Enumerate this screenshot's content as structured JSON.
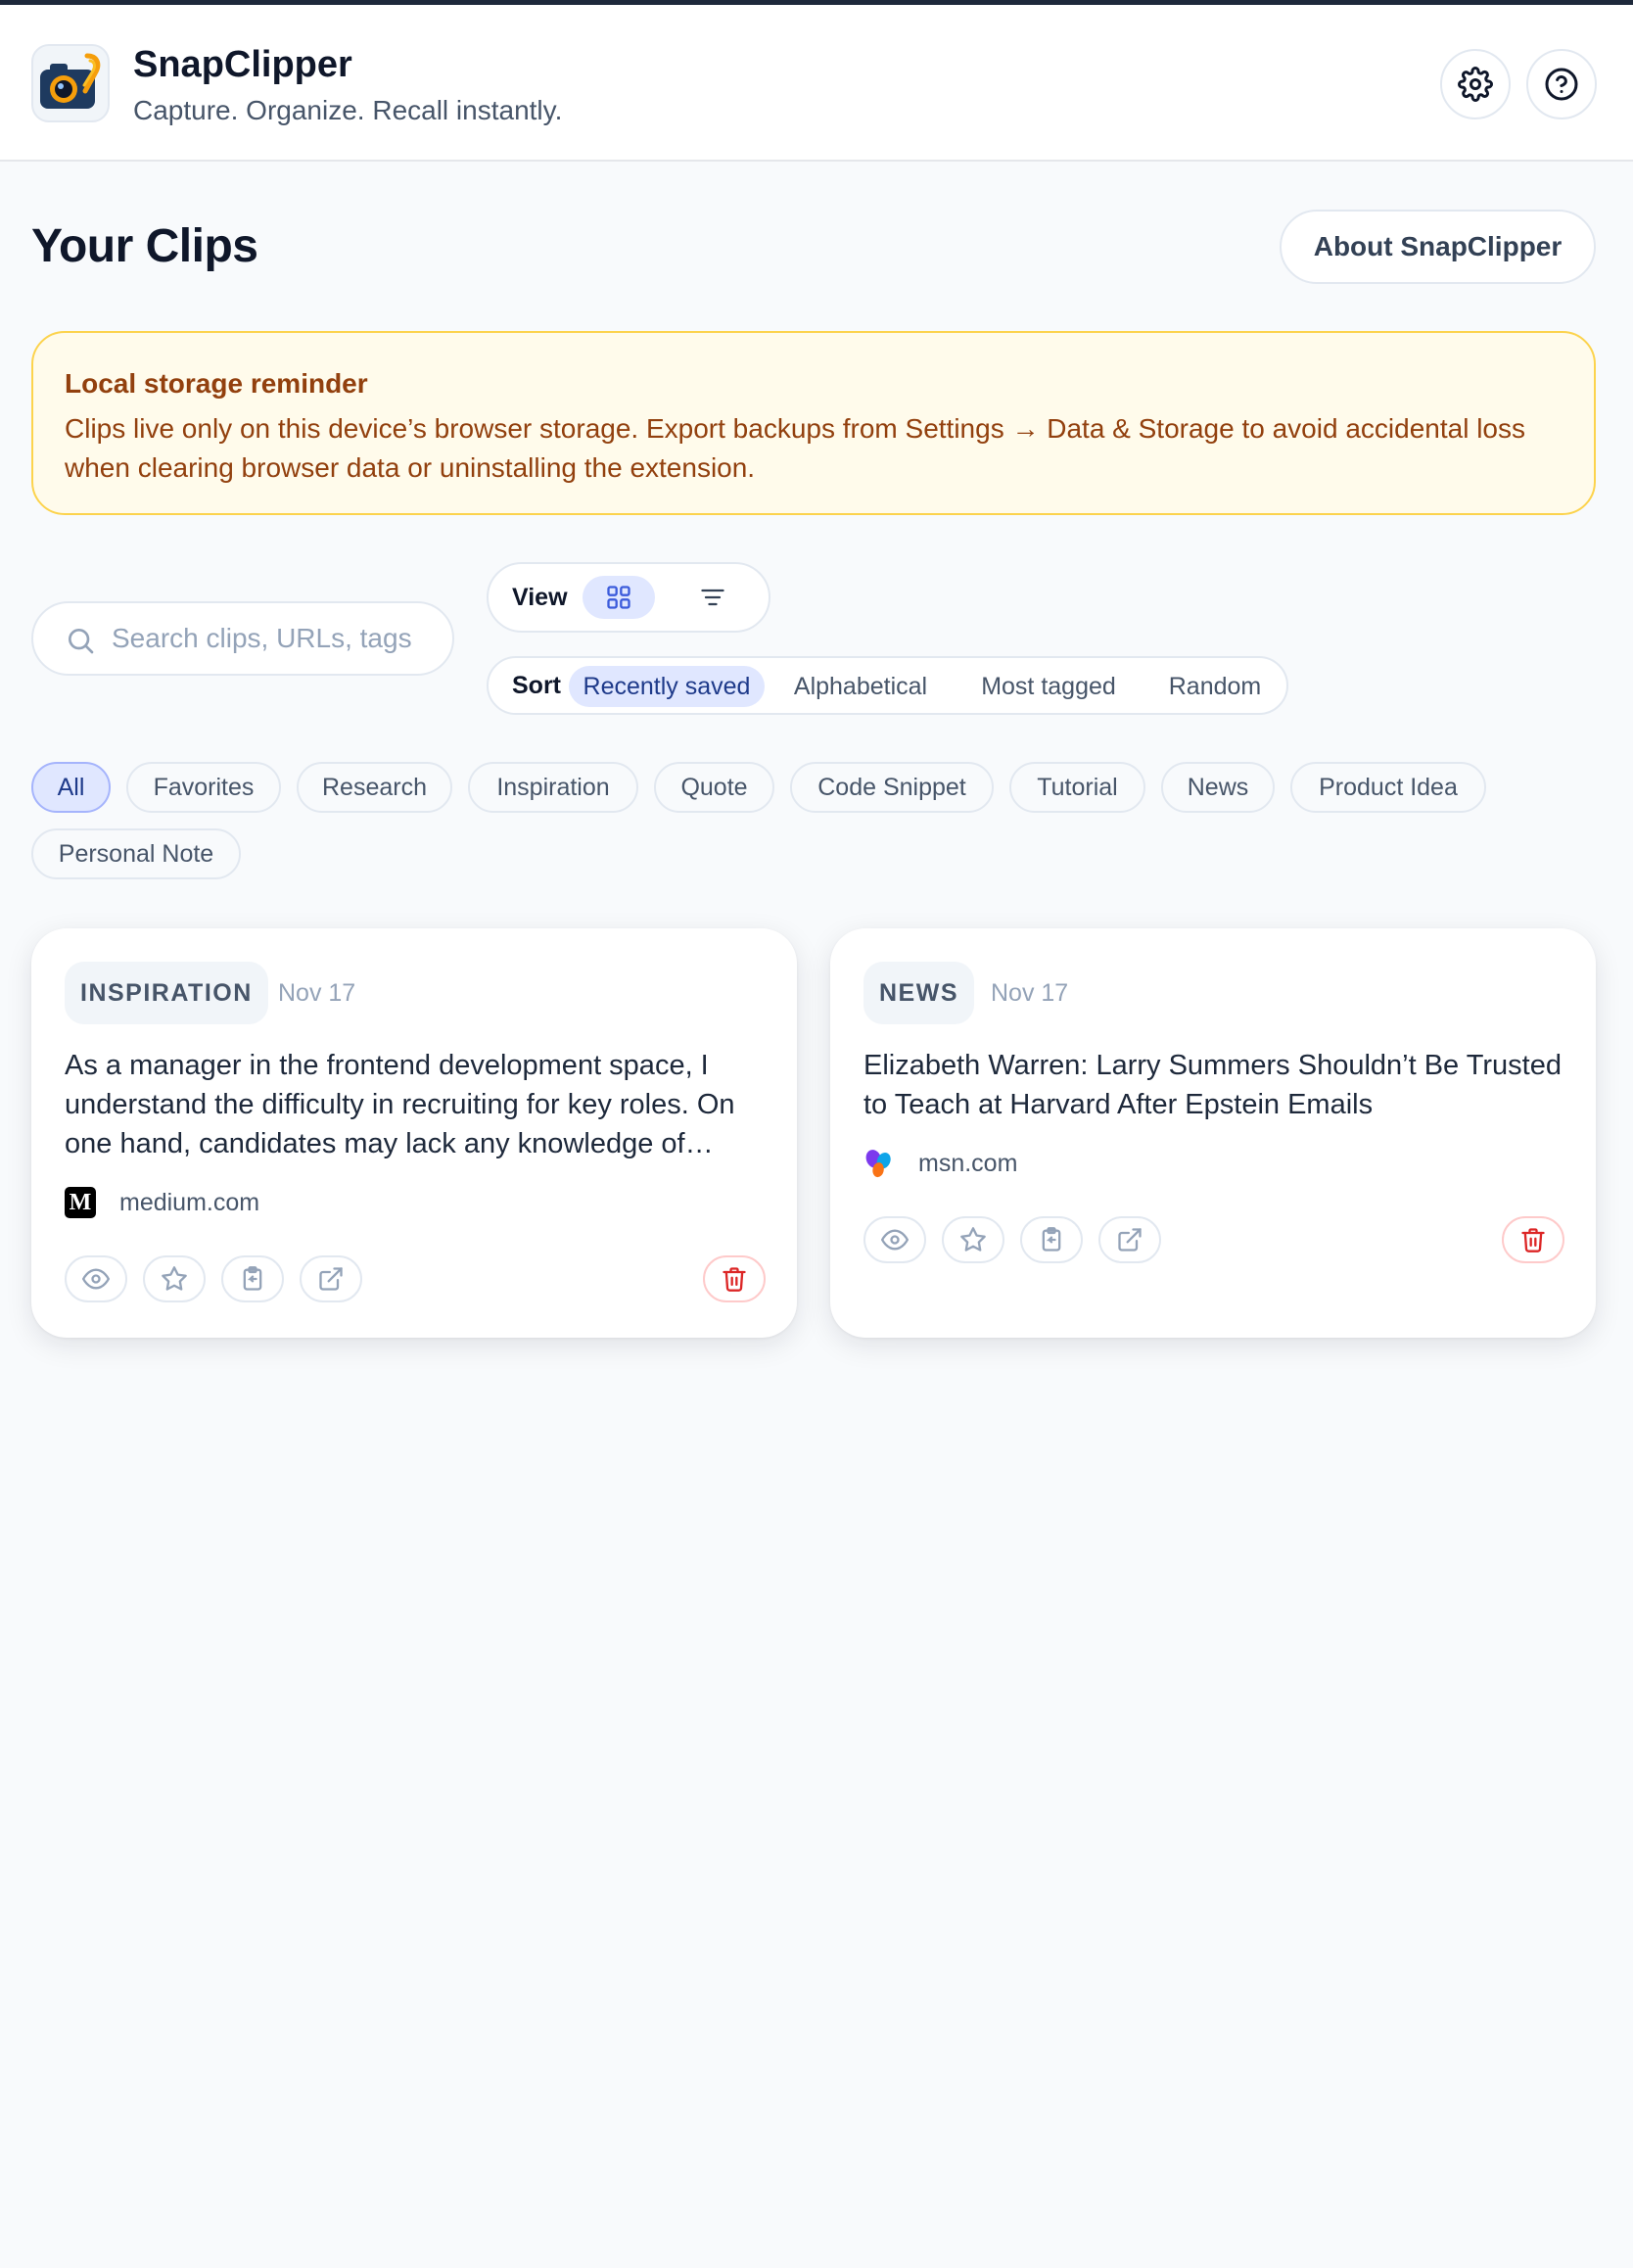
{
  "header": {
    "app_name": "SnapClipper",
    "tagline": "Capture. Organize. Recall instantly.",
    "logo_icon": "camera-clip-logo",
    "settings_icon": "gear-icon",
    "help_icon": "help-circle-icon"
  },
  "main": {
    "title": "Your Clips",
    "about_label": "About SnapClipper"
  },
  "reminder": {
    "title": "Local storage reminder",
    "body": "Clips live only on this device’s browser storage. Export backups from Settings → Data & Storage to avoid accidental loss when clearing browser data or uninstalling the extension."
  },
  "search": {
    "placeholder": "Search clips, URLs, tags",
    "value": ""
  },
  "view": {
    "label": "View",
    "selected": "grid"
  },
  "sort": {
    "label": "Sort",
    "options": [
      "Recently saved",
      "Alphabetical",
      "Most tagged",
      "Random"
    ],
    "selected": "Recently saved"
  },
  "filters": {
    "items": [
      "All",
      "Favorites",
      "Research",
      "Inspiration",
      "Quote",
      "Code Snippet",
      "Tutorial",
      "News",
      "Product Idea",
      "Personal Note"
    ],
    "selected": "All"
  },
  "clips": [
    {
      "category": "INSPIRATION",
      "date": "Nov 17",
      "text": "As a manager in the frontend development space, I understand the difficulty in recruiting for key roles. On one hand, candidates may lack any knowledge of…",
      "source": "medium.com",
      "source_icon_text": "M"
    },
    {
      "category": "NEWS",
      "date": "Nov 17",
      "text": "Elizabeth Warren: Larry Summers Shouldn’t Be Trusted to Teach at Harvard After Epstein Emails",
      "source": "msn.com"
    }
  ],
  "colors": {
    "accent_bg": "#e0e7ff",
    "accent_text": "#1e3a8a",
    "warning_bg": "#fffbeb",
    "warning_border": "#fcd34d",
    "warning_text": "#92400e",
    "danger": "#dc2626"
  }
}
